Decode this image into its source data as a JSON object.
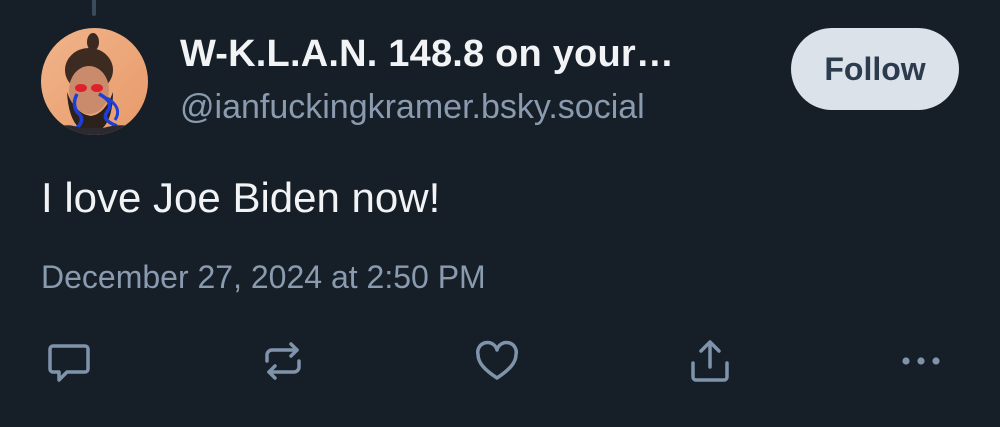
{
  "post": {
    "author": {
      "display_name": "W-K.L.A.N. 148.8 on your…",
      "handle": "@ianfuckingkramer.bsky.social",
      "avatar": "avatar-photo"
    },
    "follow_label": "Follow",
    "text": "I love Joe Biden now!",
    "timestamp": "December 27, 2024 at 2:50 PM"
  },
  "actions": [
    {
      "name": "reply",
      "icon": "reply-icon"
    },
    {
      "name": "repost",
      "icon": "repost-icon"
    },
    {
      "name": "like",
      "icon": "heart-icon"
    },
    {
      "name": "share",
      "icon": "share-icon"
    },
    {
      "name": "more",
      "icon": "more-icon"
    }
  ],
  "colors": {
    "background": "#161e27",
    "primary_text": "#f1f3f5",
    "secondary_text": "#8a9bb0",
    "follow_button_bg": "#dce2ea",
    "follow_button_text": "#2c3b4e",
    "icon": "#7f93aa"
  }
}
